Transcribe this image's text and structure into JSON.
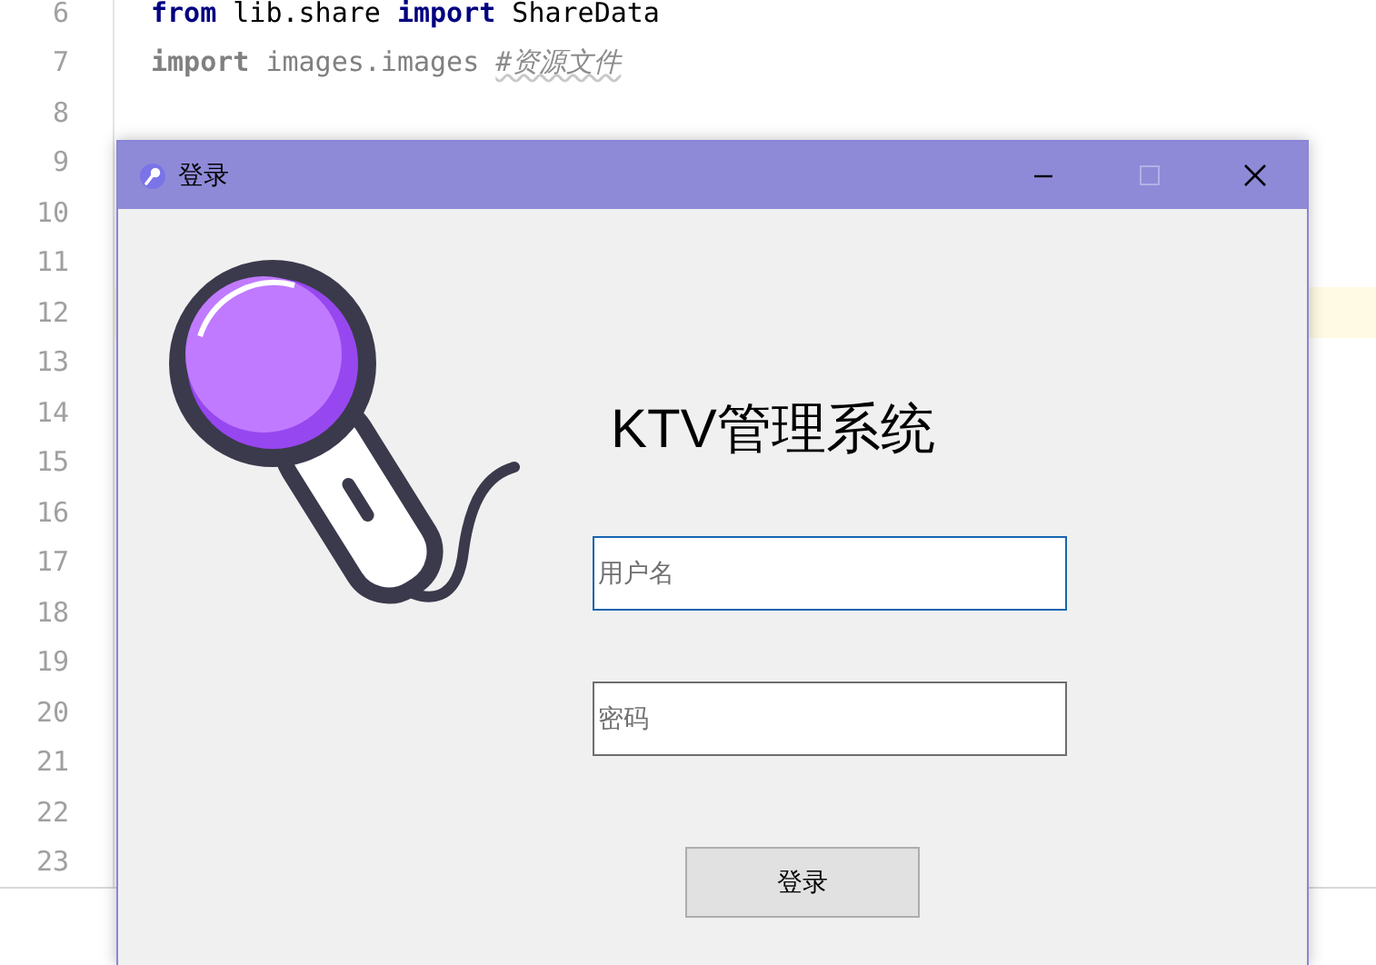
{
  "editor": {
    "lines": [
      {
        "number": "6",
        "current": false,
        "tokens": [
          {
            "kind": "keyword",
            "text": "from"
          },
          {
            "kind": "plain",
            "text": " lib.share "
          },
          {
            "kind": "keyword",
            "text": "import"
          },
          {
            "kind": "plain",
            "text": " ShareData"
          }
        ]
      },
      {
        "number": "7",
        "current": false,
        "tokens": [
          {
            "kind": "unused-keyword",
            "text": "import"
          },
          {
            "kind": "unused",
            "text": " images.images "
          },
          {
            "kind": "comment",
            "text": "#资源文件"
          }
        ]
      },
      {
        "number": "8",
        "current": false
      },
      {
        "number": "9",
        "current": false
      },
      {
        "number": "10",
        "current": false
      },
      {
        "number": "11",
        "current": false
      },
      {
        "number": "12",
        "current": true
      },
      {
        "number": "13",
        "current": false
      },
      {
        "number": "14",
        "current": false
      },
      {
        "number": "15",
        "current": false
      },
      {
        "number": "16",
        "current": false
      },
      {
        "number": "17",
        "current": false
      },
      {
        "number": "18",
        "current": false
      },
      {
        "number": "19",
        "current": false
      },
      {
        "number": "20",
        "current": false
      },
      {
        "number": "21",
        "current": false
      },
      {
        "number": "22",
        "current": false
      },
      {
        "number": "23",
        "current": false
      }
    ]
  },
  "dialog": {
    "title": "登录",
    "controls": [
      {
        "kind": "minimize",
        "disabled": false
      },
      {
        "kind": "maximize",
        "disabled": true
      },
      {
        "kind": "close",
        "disabled": false
      }
    ],
    "heading": "KTV管理系统",
    "fields": [
      {
        "placeholder": "用户名",
        "focused": true
      },
      {
        "placeholder": "密码",
        "focused": false
      }
    ],
    "button": "登录"
  }
}
